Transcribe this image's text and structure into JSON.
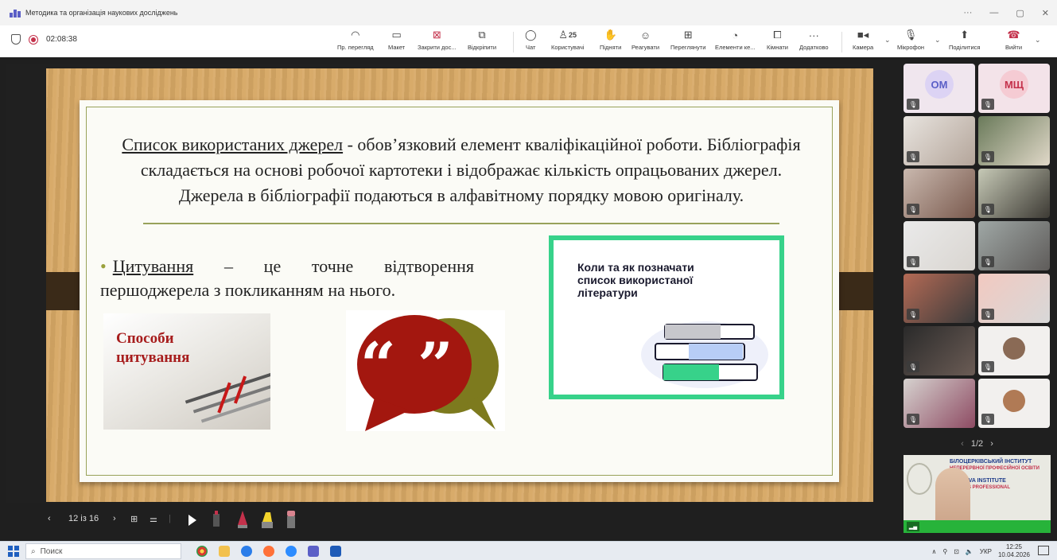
{
  "window": {
    "title": "Методика та організація наукових досліджень",
    "ctrl_more": "···",
    "ctrl_min": "—",
    "ctrl_restore": "▢",
    "ctrl_close": "✕"
  },
  "meeting": {
    "timer": "02:08:38",
    "toolbar": {
      "preview": "Пр. перегляд",
      "layout": "Макет",
      "close_share": "Закрити дос...",
      "popout": "Відкріпити",
      "chat": "Чат",
      "people": "Користувачі",
      "people_count": "25",
      "raise": "Підняти",
      "react": "Реагувати",
      "view": "Переглянути",
      "apps": "Елементи ке...",
      "rooms": "Кімнати",
      "more": "Додатково",
      "camera": "Камера",
      "mic": "Мікрофон",
      "share": "Поділитися",
      "leave": "Вийти"
    }
  },
  "slide": {
    "para_title": "Список використаних джерел",
    "para_rest": " - обов’язковий елемент кваліфікаційної роботи. Бібліографія складається на основі робочої картотеки і відображає кількість опрацьованих джерел. Джерела в бібліографії подаються в алфавітному порядку мовою оригіналу.",
    "bullet_term": "Цитування",
    "bullet_rest": " – це точне відтворення першоджерела з покликанням на нього.",
    "image_sposoby": "Способи цитування",
    "image_books": "Коли та як позначати список використаної літератури"
  },
  "slide_controls": {
    "prev": "‹",
    "counter": "12 із 16",
    "next": "›"
  },
  "gallery": {
    "participants": [
      {
        "initials": "ОМ",
        "color": "#5b5fc7"
      },
      {
        "initials": "МЩ",
        "color": "#c4314b"
      }
    ],
    "pager": "1/2",
    "pip_text_1": "БІЛОЦЕРКІВСЬКИЙ ІНСТИТУТ",
    "pip_text_2": "НЕПЕРЕРВНОЇ ПРОФЕСІЙНОЇ ОСВІТИ",
    "pip_text_3": "TSERKVA INSTITUTE",
    "pip_text_4": "TINUOUS PROFESSIONAL",
    "pip_text_5": "ION"
  },
  "taskbar": {
    "search": "Поиск",
    "lang": "УКР",
    "time": "12:25",
    "date": "10.04.2026"
  }
}
